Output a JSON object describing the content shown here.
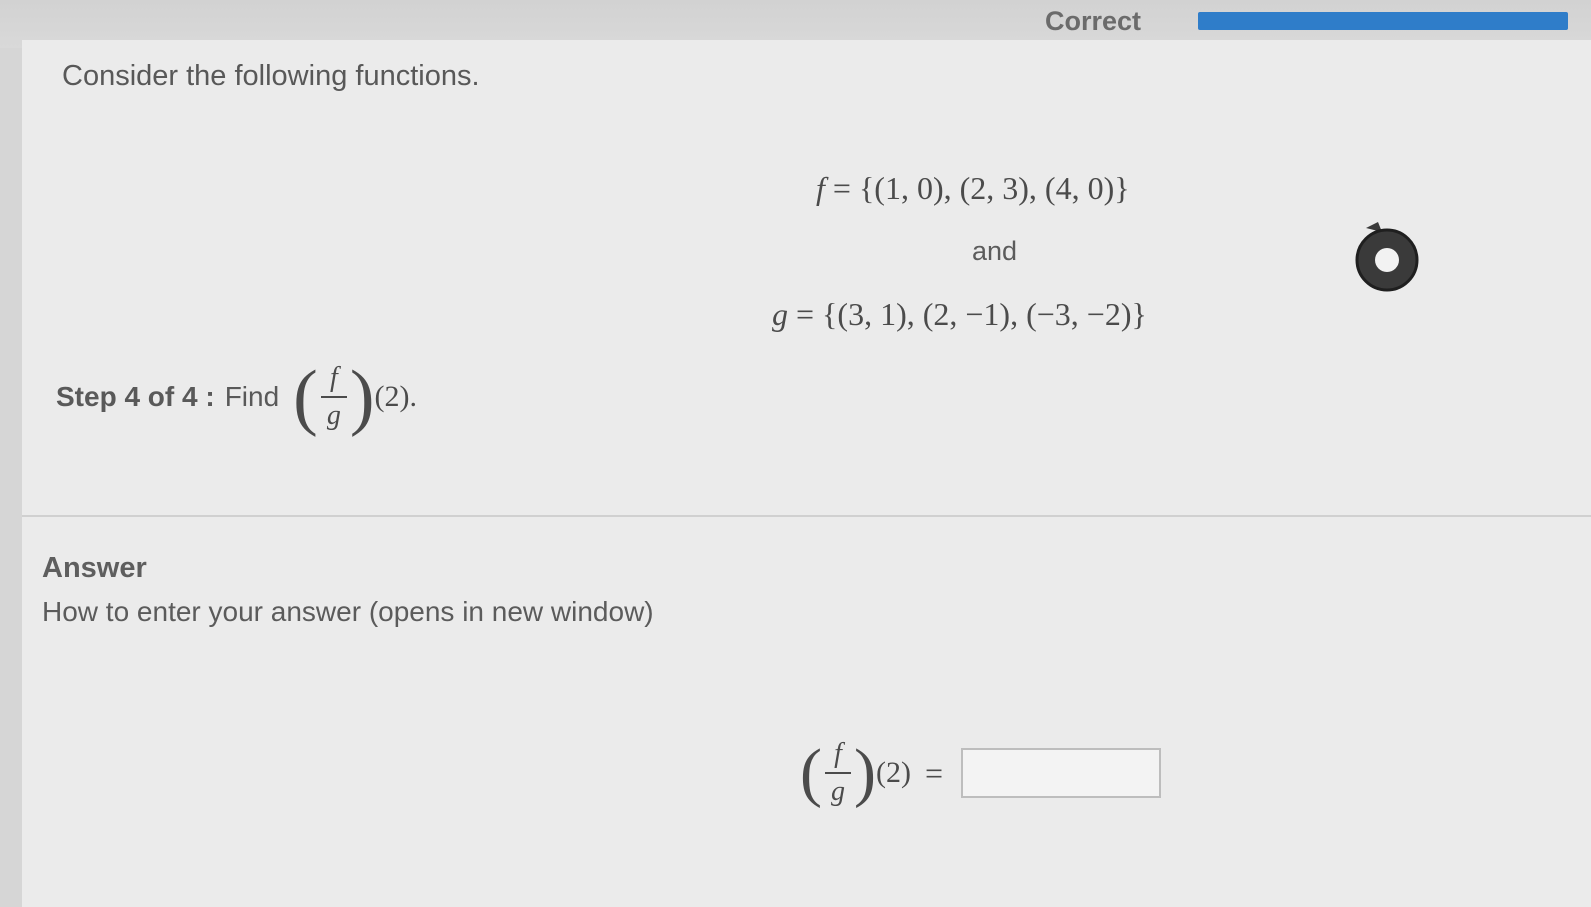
{
  "status": {
    "label": "Correct",
    "progress": 1.0
  },
  "question": {
    "prompt": "Consider the following functions.",
    "f_name": "f",
    "f_set": "{(1, 0), (2, 3), (4, 0)}",
    "and_label": "and",
    "g_name": "g",
    "g_set": "{(3, 1), (2, −1), (−3, −2)}",
    "step_label": "Step 4 of 4 :",
    "find_label": "Find",
    "frac_num": "f",
    "frac_den": "g",
    "arg": "(2).",
    "eq": "="
  },
  "answer": {
    "title": "Answer",
    "howto_link": "How to enter your answer (opens in new window)",
    "frac_num": "f",
    "frac_den": "g",
    "arg": "(2)",
    "eq": "=",
    "input_value": ""
  },
  "icons": {
    "timer": "stopwatch-icon"
  },
  "colors": {
    "accent": "#2f7dc9",
    "background": "#ebebeb"
  }
}
